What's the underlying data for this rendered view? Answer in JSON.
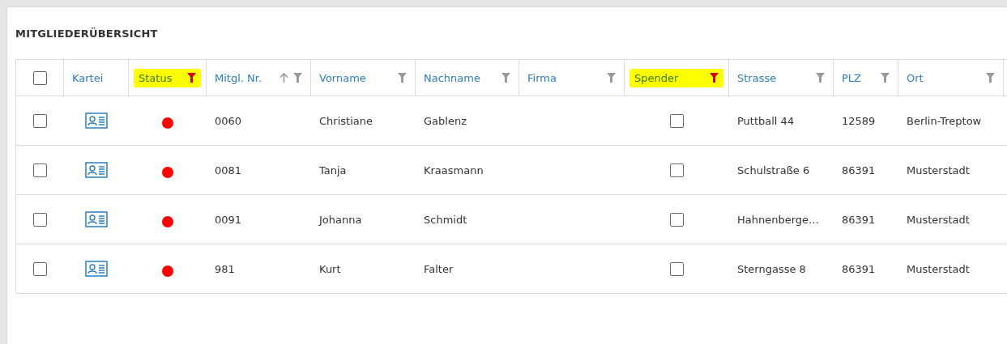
{
  "panel": {
    "title": "MITGLIEDERÜBERSICHT"
  },
  "table": {
    "select_all": {
      "checked": false
    },
    "columns": [
      {
        "label": "Kartei",
        "kind": "plain"
      },
      {
        "label": "Status",
        "kind": "filter",
        "highlighted": true,
        "filter_active": true
      },
      {
        "label": "Mitgl. Nr.",
        "kind": "filter",
        "sorted_ascending": true,
        "filter_active": false
      },
      {
        "label": "Vorname",
        "kind": "filter",
        "filter_active": false
      },
      {
        "label": "Nachname",
        "kind": "filter",
        "filter_active": false
      },
      {
        "label": "Firma",
        "kind": "filter",
        "filter_active": false
      },
      {
        "label": "Spender",
        "kind": "filter",
        "highlighted": true,
        "filter_active": true
      },
      {
        "label": "Strasse",
        "kind": "filter",
        "filter_active": false
      },
      {
        "label": "PLZ",
        "kind": "filter",
        "filter_active": false
      },
      {
        "label": "Ort",
        "kind": "filter",
        "filter_active": false
      }
    ],
    "rows": [
      {
        "checked": false,
        "color": "#ff0000",
        "number": "0060",
        "first_name": "Christiane",
        "last_name": "Gablenz",
        "donor": false,
        "street": "Puttball 44",
        "zip": "12589",
        "city": "Berlin-Treptow"
      },
      {
        "checked": false,
        "color": "#ff0000",
        "number": "0081",
        "first_name": "Tanja",
        "last_name": "Kraasmann",
        "donor": false,
        "street": "Schulstraße 6",
        "zip": "86391",
        "city": "Musterstadt"
      },
      {
        "checked": false,
        "color": "#ff0000",
        "number": "0091",
        "first_name": "Johanna",
        "last_name": "Schmidt",
        "donor": false,
        "street": "Hahnenberge…",
        "zip": "86391",
        "city": "Musterstadt"
      },
      {
        "checked": false,
        "color": "#ff0000",
        "number": "981",
        "first_name": "Kurt",
        "last_name": "Falter",
        "donor": false,
        "street": "Sterngasse 8",
        "zip": "86391",
        "city": "Musterstadt"
      }
    ]
  }
}
